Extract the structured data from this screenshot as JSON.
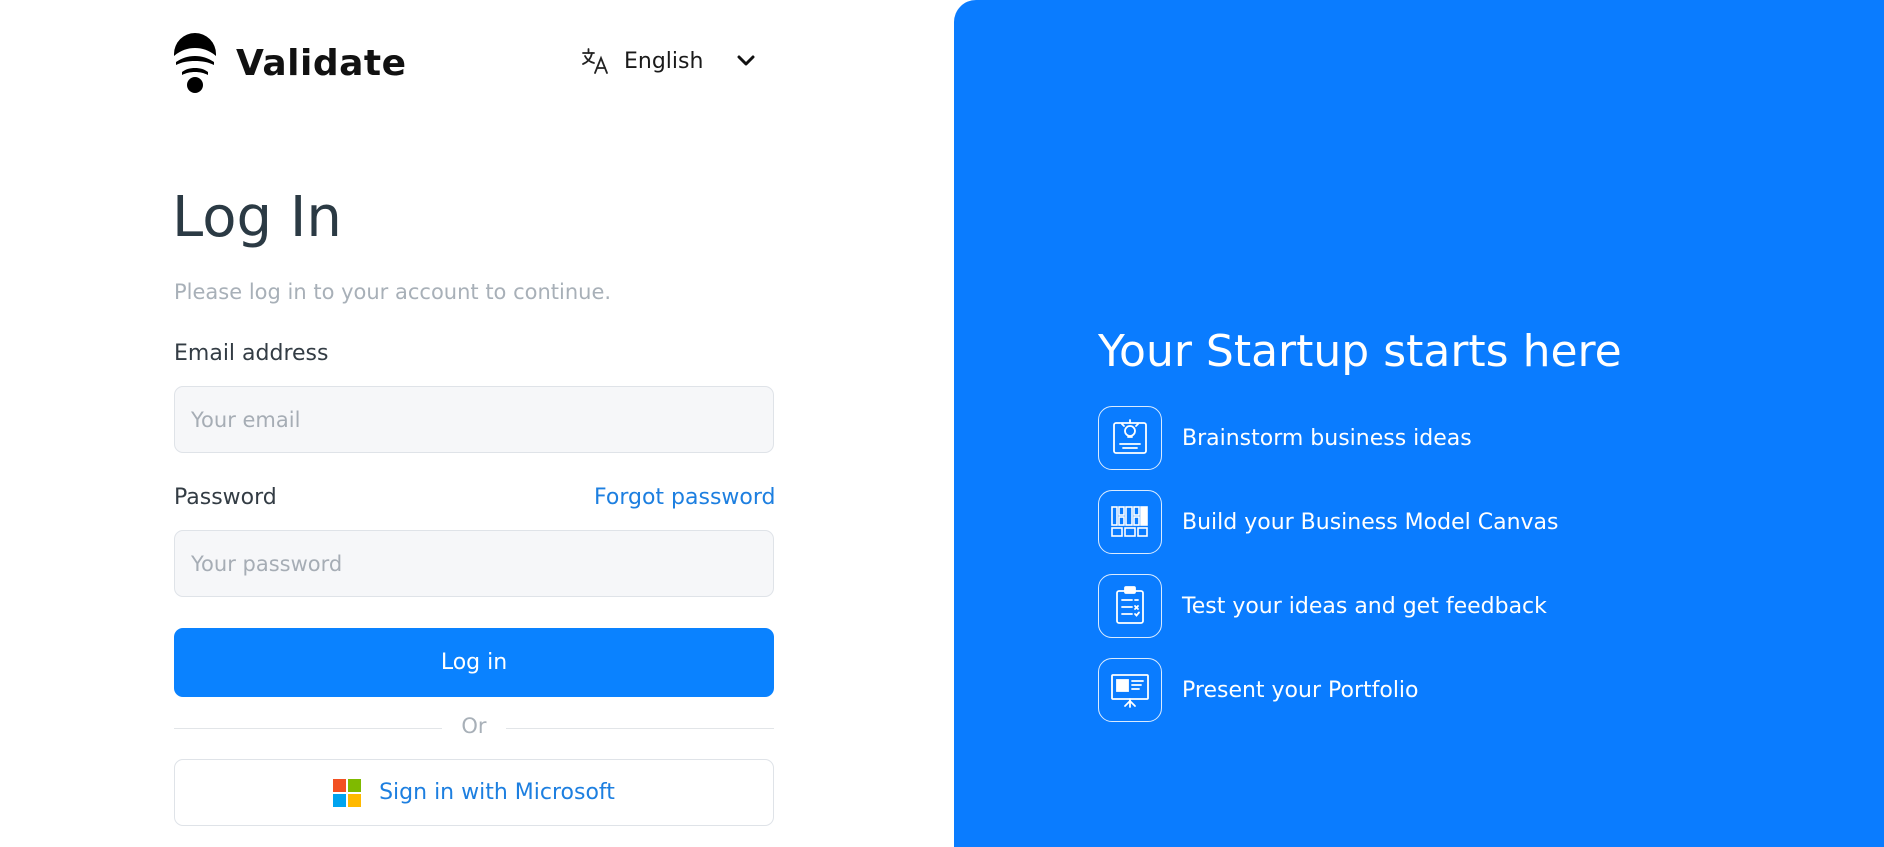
{
  "brand": {
    "name": "Validate"
  },
  "language": {
    "selected": "English"
  },
  "login": {
    "title": "Log In",
    "subtitle": "Please log in to your account to continue.",
    "email_label": "Email address",
    "email_placeholder": "Your email",
    "email_value": "",
    "password_label": "Password",
    "password_placeholder": "Your password",
    "password_value": "",
    "forgot_label": "Forgot password",
    "submit_label": "Log in",
    "divider_label": "Or",
    "microsoft_label": "Sign in with Microsoft"
  },
  "promo": {
    "headline": "Your Startup starts here",
    "features": [
      {
        "icon": "lightbulb-board-icon",
        "label": "Brainstorm business ideas"
      },
      {
        "icon": "canvas-grid-icon",
        "label": "Build your Business Model Canvas"
      },
      {
        "icon": "clipboard-checklist-icon",
        "label": "Test your ideas and get feedback"
      },
      {
        "icon": "presentation-board-icon",
        "label": "Present your Portfolio"
      }
    ]
  },
  "colors": {
    "accent": "#0a82ff",
    "panel": "#0a7cff",
    "link": "#1d7fe0",
    "microsoft": [
      "#f25022",
      "#7fba00",
      "#00a4ef",
      "#ffb900"
    ]
  }
}
